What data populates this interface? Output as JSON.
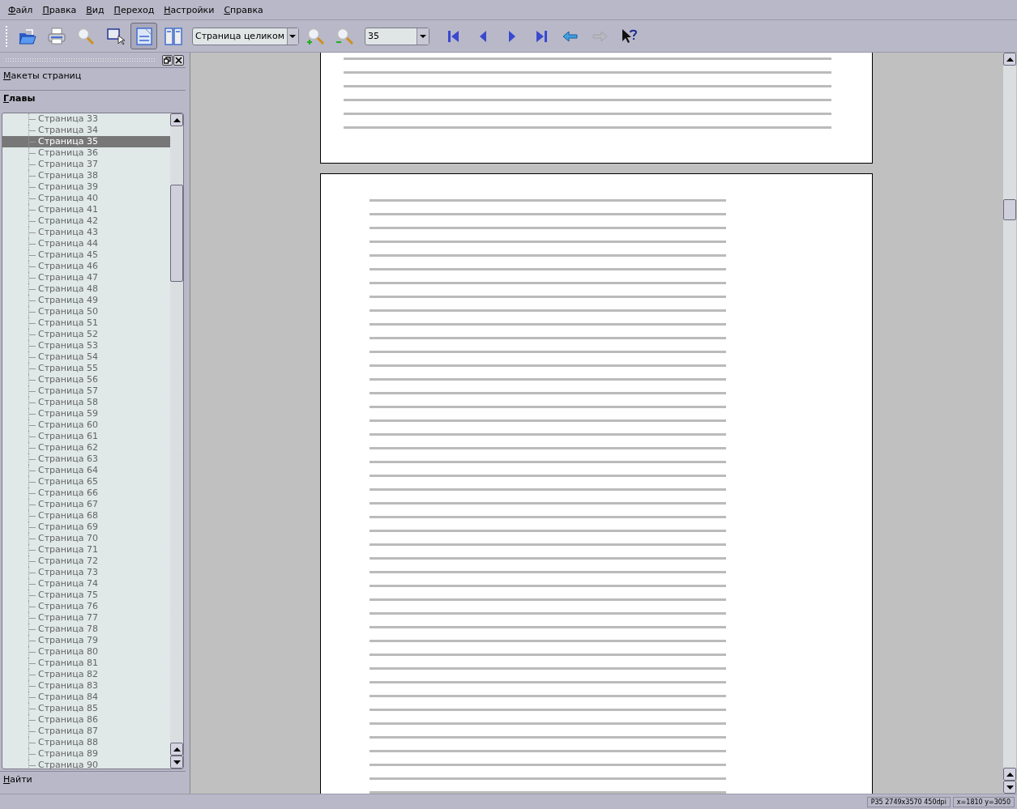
{
  "menu": [
    {
      "label": "Файл"
    },
    {
      "label": "Правка"
    },
    {
      "label": "Вид"
    },
    {
      "label": "Переход"
    },
    {
      "label": "Настройки"
    },
    {
      "label": "Справка"
    }
  ],
  "toolbar": [
    {
      "kind": "button",
      "pressed": false,
      "disabled": false
    },
    {
      "kind": "button",
      "pressed": false,
      "disabled": false
    },
    {
      "kind": "button",
      "pressed": false,
      "disabled": false
    },
    {
      "kind": "button",
      "pressed": false,
      "disabled": false
    },
    {
      "kind": "button",
      "pressed": true,
      "disabled": false
    },
    {
      "kind": "button",
      "pressed": false,
      "disabled": false
    },
    {
      "kind": "combo",
      "value": "Страница целиком"
    },
    {
      "kind": "button",
      "pressed": false,
      "disabled": false
    },
    {
      "kind": "button",
      "pressed": false,
      "disabled": false
    },
    {
      "kind": "combo",
      "value": "35"
    },
    {
      "kind": "button",
      "pressed": false,
      "disabled": false
    },
    {
      "kind": "button",
      "pressed": false,
      "disabled": false
    },
    {
      "kind": "button",
      "pressed": false,
      "disabled": false
    },
    {
      "kind": "button",
      "pressed": false,
      "disabled": false
    },
    {
      "kind": "button",
      "pressed": false,
      "disabled": false
    },
    {
      "kind": "button",
      "pressed": false,
      "disabled": true
    },
    {
      "kind": "button",
      "pressed": false,
      "disabled": false
    }
  ],
  "sidebar": {
    "tabs": [
      {
        "label": "Макеты страниц",
        "selected": false
      },
      {
        "label": "Главы",
        "selected": true
      }
    ],
    "items": [
      {
        "label": "Страница 33",
        "selected": false
      },
      {
        "label": "Страница 34",
        "selected": false
      },
      {
        "label": "Страница 35",
        "selected": true
      },
      {
        "label": "Страница 36",
        "selected": false
      },
      {
        "label": "Страница 37",
        "selected": false
      },
      {
        "label": "Страница 38",
        "selected": false
      },
      {
        "label": "Страница 39",
        "selected": false
      },
      {
        "label": "Страница 40",
        "selected": false
      },
      {
        "label": "Страница 41",
        "selected": false
      },
      {
        "label": "Страница 42",
        "selected": false
      },
      {
        "label": "Страница 43",
        "selected": false
      },
      {
        "label": "Страница 44",
        "selected": false
      },
      {
        "label": "Страница 45",
        "selected": false
      },
      {
        "label": "Страница 46",
        "selected": false
      },
      {
        "label": "Страница 47",
        "selected": false
      },
      {
        "label": "Страница 48",
        "selected": false
      },
      {
        "label": "Страница 49",
        "selected": false
      },
      {
        "label": "Страница 50",
        "selected": false
      },
      {
        "label": "Страница 51",
        "selected": false
      },
      {
        "label": "Страница 52",
        "selected": false
      },
      {
        "label": "Страница 53",
        "selected": false
      },
      {
        "label": "Страница 54",
        "selected": false
      },
      {
        "label": "Страница 55",
        "selected": false
      },
      {
        "label": "Страница 56",
        "selected": false
      },
      {
        "label": "Страница 57",
        "selected": false
      },
      {
        "label": "Страница 58",
        "selected": false
      },
      {
        "label": "Страница 59",
        "selected": false
      },
      {
        "label": "Страница 60",
        "selected": false
      },
      {
        "label": "Страница 61",
        "selected": false
      },
      {
        "label": "Страница 62",
        "selected": false
      },
      {
        "label": "Страница 63",
        "selected": false
      },
      {
        "label": "Страница 64",
        "selected": false
      },
      {
        "label": "Страница 65",
        "selected": false
      },
      {
        "label": "Страница 66",
        "selected": false
      },
      {
        "label": "Страница 67",
        "selected": false
      },
      {
        "label": "Страница 68",
        "selected": false
      },
      {
        "label": "Страница 69",
        "selected": false
      },
      {
        "label": "Страница 70",
        "selected": false
      },
      {
        "label": "Страница 71",
        "selected": false
      },
      {
        "label": "Страница 72",
        "selected": false
      },
      {
        "label": "Страница 73",
        "selected": false
      },
      {
        "label": "Страница 74",
        "selected": false
      },
      {
        "label": "Страница 75",
        "selected": false
      },
      {
        "label": "Страница 76",
        "selected": false
      },
      {
        "label": "Страница 77",
        "selected": false
      },
      {
        "label": "Страница 78",
        "selected": false
      },
      {
        "label": "Страница 79",
        "selected": false
      },
      {
        "label": "Страница 80",
        "selected": false
      },
      {
        "label": "Страница 81",
        "selected": false
      },
      {
        "label": "Страница 82",
        "selected": false
      },
      {
        "label": "Страница 83",
        "selected": false
      },
      {
        "label": "Страница 84",
        "selected": false
      },
      {
        "label": "Страница 85",
        "selected": false
      },
      {
        "label": "Страница 86",
        "selected": false
      },
      {
        "label": "Страница 87",
        "selected": false
      },
      {
        "label": "Страница 88",
        "selected": false
      },
      {
        "label": "Страница 89",
        "selected": false
      },
      {
        "label": "Страница 90",
        "selected": false
      }
    ],
    "bottom_tab": {
      "label": "Найти",
      "selected": false
    }
  },
  "status_bar": [
    {
      "text": "P35 2749x3570 450dpi"
    },
    {
      "text": "x=1810 y=3050"
    }
  ]
}
